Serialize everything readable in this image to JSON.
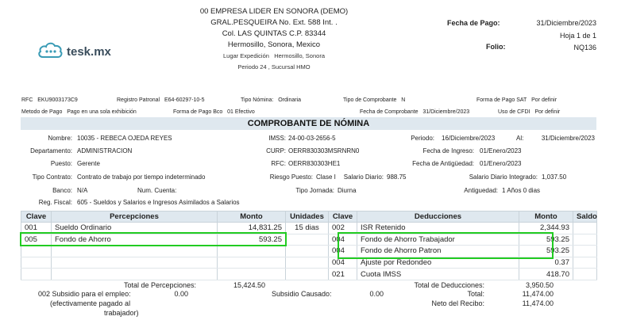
{
  "company": {
    "name": "00 EMPRESA LIDER EN SONORA (DEMO)",
    "street": "GRAL.PESQUEIRA No. Ext. 588 Int. .",
    "colonia": "Col. LAS QUINTAS C.P. 83344",
    "city": "Hermosillo, Sonora, Mexico",
    "lugar_label": "Lugar Expedición",
    "lugar_value": "Hermosillo, Sonora",
    "periodo": "Periodo 24 , Sucursal HMO"
  },
  "logo": {
    "text": "tesk.mx",
    "icon": "cloud-logo-icon",
    "color": "#3a9bb5"
  },
  "header_right": {
    "fecha_pago_label": "Fecha de Pago:",
    "fecha_pago_value": "31/Diciembre/2023",
    "hoja": "Hoja 1 de 1",
    "folio_label": "Folio:",
    "folio_value": "NQ136"
  },
  "fiscal": {
    "rfc_label": "RFC",
    "rfc_value": "EKU9003173C9",
    "registro_label": "Registro Patronal",
    "registro_value": "E64-60297-10-5",
    "tipo_nomina_label": "Tipo Nómina:",
    "tipo_nomina_value": "Ordinaria",
    "tipo_comprobante_label": "Tipo de Comprobante",
    "tipo_comprobante_value": "N",
    "forma_pago_sat_label": "Forma de Pago SAT",
    "forma_pago_sat_value": "Por definir",
    "metodo_pago_label": "Metodo de Pago",
    "metodo_pago_value": "Pago en una sola exhibición",
    "forma_pago_bco_label": "Forma de Pago Bco",
    "forma_pago_bco_value": "01 Efectivo",
    "fecha_comprobante_label": "Fecha de Comprobante",
    "fecha_comprobante_value": "31/Diciembre/2023",
    "uso_cfdi_label": "Uso de CFDI",
    "uso_cfdi_value": "Por definir"
  },
  "banner": "COMPROBANTE DE NÓMINA",
  "employee": {
    "nombre_label": "Nombre:",
    "nombre_value": "10035 - REBECA OJEDA REYES",
    "imss_label": "IMSS:",
    "imss_value": "24-00-03-2656-5",
    "periodo_label": "Periodo:",
    "periodo_value": "16/Diciembre/2023",
    "al_label": "Al:",
    "al_value": "31/Diciembre/2023",
    "depto_label": "Departamento:",
    "depto_value": "ADMINISTRACION",
    "curp_label": "CURP:",
    "curp_value": "OERR830303MSRNRN0",
    "ingreso_label": "Fecha de Ingreso:",
    "ingreso_value": "01/Enero/2023",
    "puesto_label": "Puesto:",
    "puesto_value": "Gerente",
    "rfc_label": "RFC:",
    "rfc_value": "OERR830303HE1",
    "antig_fecha_label": "Fecha de Antigüedad:",
    "antig_fecha_value": "01/Enero/2023",
    "contrato_label": "Tipo Contrato:",
    "contrato_value": "Contrato de trabajo por tiempo indeterminado",
    "riesgo_label": "Riesgo Puesto:",
    "riesgo_value": "Clase I",
    "salario_label": "Salario Diario:",
    "salario_value": "988.75",
    "sdi_label": "Salario Diario Integrado:",
    "sdi_value": "1,037.50",
    "banco_label": "Banco:",
    "banco_value": "N/A",
    "cuenta_label": "Num. Cuenta:",
    "cuenta_value": "",
    "jornada_label": "Tipo Jornada:",
    "jornada_value": "Diurna",
    "antiguedad_label": "Antiguedad:",
    "antiguedad_value": "1 Años 0 dias",
    "regimen_label": "Reg. Fiscal:",
    "regimen_value": "605 - Sueldos y Salarios e Ingresos Asimilados a Salarios"
  },
  "table": {
    "headers": [
      "Clave",
      "Percepciones",
      "Monto",
      "Unidades",
      "Clave",
      "Deducciones",
      "Monto",
      "Saldo"
    ],
    "rows": [
      [
        "001",
        "Sueldo Ordinario",
        "14,831.25",
        "15 dias",
        "002",
        "ISR Retenido",
        "2,344.93",
        ""
      ],
      [
        "005",
        "Fondo de Ahorro",
        "593.25",
        "",
        "004",
        "Fondo de Ahorro Trabajador",
        "593.25",
        ""
      ],
      [
        "",
        "",
        "",
        "",
        "004",
        "Fondo de Ahorro Patron",
        "593.25",
        ""
      ],
      [
        "",
        "",
        "",
        "",
        "004",
        "Ajuste por Redondeo",
        "0.37",
        ""
      ],
      [
        "",
        "",
        "",
        "",
        "021",
        "Cuota IMSS",
        "418.70",
        ""
      ]
    ]
  },
  "totals": {
    "total_percepciones_label": "Total de Percepciones:",
    "total_percepciones_value": "15,424.50",
    "subsidio_label": "002 Subsidio para el empleo:",
    "subsidio_value": "0.00",
    "subsidio_note1": "(efectivamente pagado al",
    "subsidio_note2": "trabajador)",
    "subsidio_causado_label": "Subsidio Causado:",
    "subsidio_causado_value": "0.00",
    "total_deducciones_label": "Total de Deducciones:",
    "total_deducciones_value": "3,950.50",
    "total_label": "Total:",
    "total_value": "11,474.00",
    "neto_label": "Neto del Recibo:",
    "neto_value": "11,474.00"
  },
  "highlight_color": "#22cc22"
}
